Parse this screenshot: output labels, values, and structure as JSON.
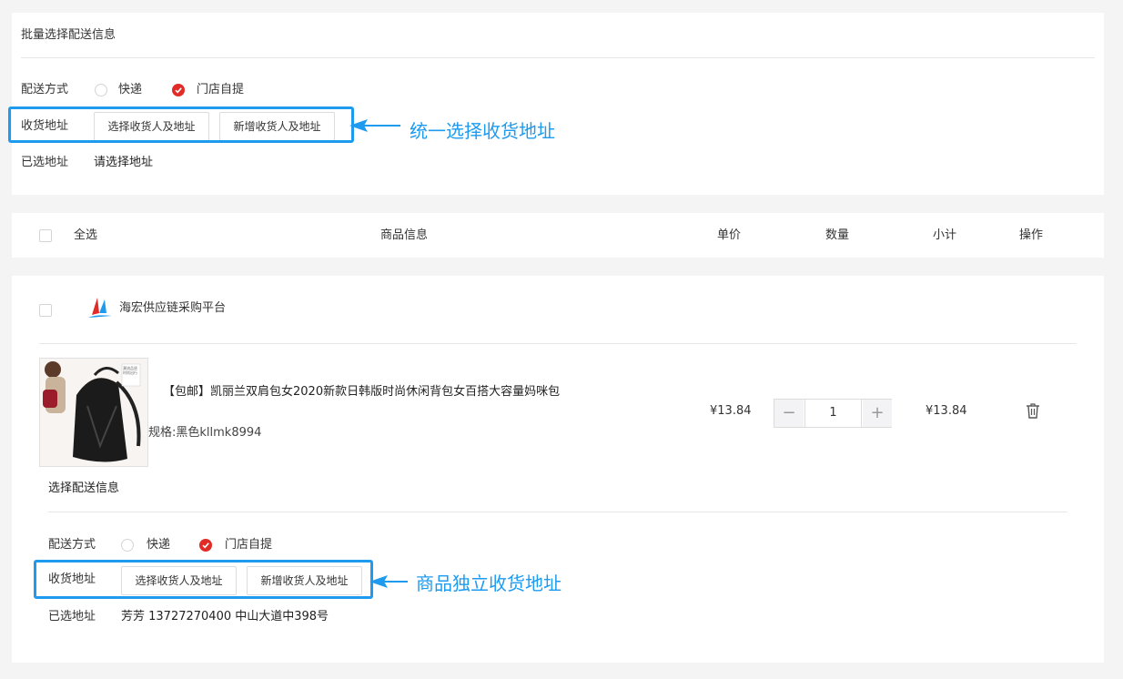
{
  "batch": {
    "title": "批量选择配送信息",
    "delivery_label": "配送方式",
    "option_express": "快递",
    "option_pickup": "门店自提",
    "address_label": "收货地址",
    "select_btn": "选择收货人及地址",
    "add_btn": "新增收货人及地址",
    "selected_label": "已选地址",
    "selected_value": "请选择地址",
    "annotation": "统一选择收货地址"
  },
  "table_header": {
    "select_all": "全选",
    "product_info": "商品信息",
    "unit_price": "单价",
    "quantity": "数量",
    "subtotal": "小计",
    "actions": "操作"
  },
  "shop": {
    "name": "海宏供应链采购平台",
    "item": {
      "title": "【包邮】凯丽兰双肩包女2020新款日韩版时尚休闲背包女百搭大容量妈咪包",
      "spec": "规格:黑色kllmk8994",
      "price": "¥13.84",
      "quantity": "1",
      "subtotal": "¥13.84",
      "thumb_caption": "潮流品质 时尚出行"
    },
    "delivery": {
      "title": "选择配送信息",
      "delivery_label": "配送方式",
      "option_express": "快递",
      "option_pickup": "门店自提",
      "address_label": "收货地址",
      "select_btn": "选择收货人及地址",
      "add_btn": "新增收货人及地址",
      "selected_label": "已选地址",
      "selected_value": "芳芳 13727270400 中山大道中398号",
      "annotation": "商品独立收货地址"
    }
  },
  "colors": {
    "accent_red": "#e02b27",
    "annotation_blue": "#1e9bef",
    "background": "#f4f4f4"
  }
}
